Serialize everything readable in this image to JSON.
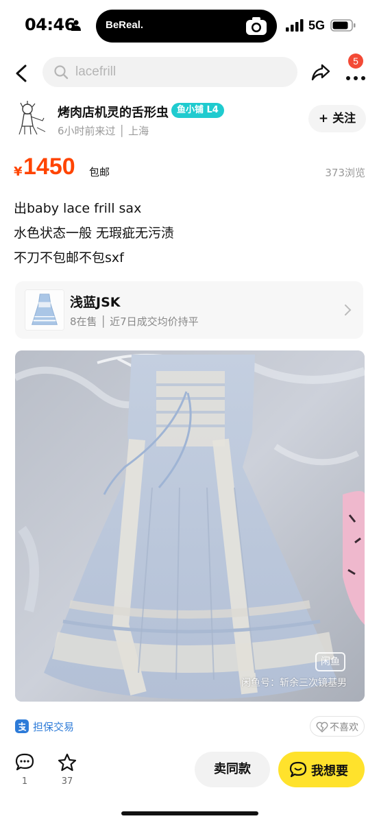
{
  "status_bar": {
    "time": "04:46",
    "island_app": "BeReal.",
    "network": "5G"
  },
  "nav": {
    "search_placeholder": "lacefrill",
    "notification_count": "5",
    "icons": [
      "back-arrow-icon",
      "search-icon",
      "share-icon",
      "more-icon"
    ]
  },
  "seller": {
    "name": "烤肉店机灵的舌形虫",
    "shop_badge": "鱼小铺 L4",
    "meta": "6小时前来过 │ 上海",
    "follow_label": "+ 关注"
  },
  "listing": {
    "currency": "¥",
    "price": "1450",
    "shipping": "包邮",
    "views": "373浏览",
    "price_color": "#ff4400",
    "description_lines": [
      "出baby lace frill sax",
      "水色状态一般 无瑕疵无污渍",
      "不刀不包邮不包sxf"
    ]
  },
  "related": {
    "title": "浅蓝JSK",
    "meta": "8在售 │ 近7日成交均价持平"
  },
  "photo": {
    "watermark_logo": "闲鱼",
    "watermark": "闲鱼号：斩余三次镜基男"
  },
  "guarantee": {
    "label": "担保交易",
    "dislike_label": "不喜欢",
    "accent": "#2d7bd8"
  },
  "bottom_bar": {
    "comment_count": "1",
    "favorite_count": "37",
    "sell_same_label": "卖同款",
    "want_label": "我想要",
    "want_color": "#ffe22c"
  }
}
